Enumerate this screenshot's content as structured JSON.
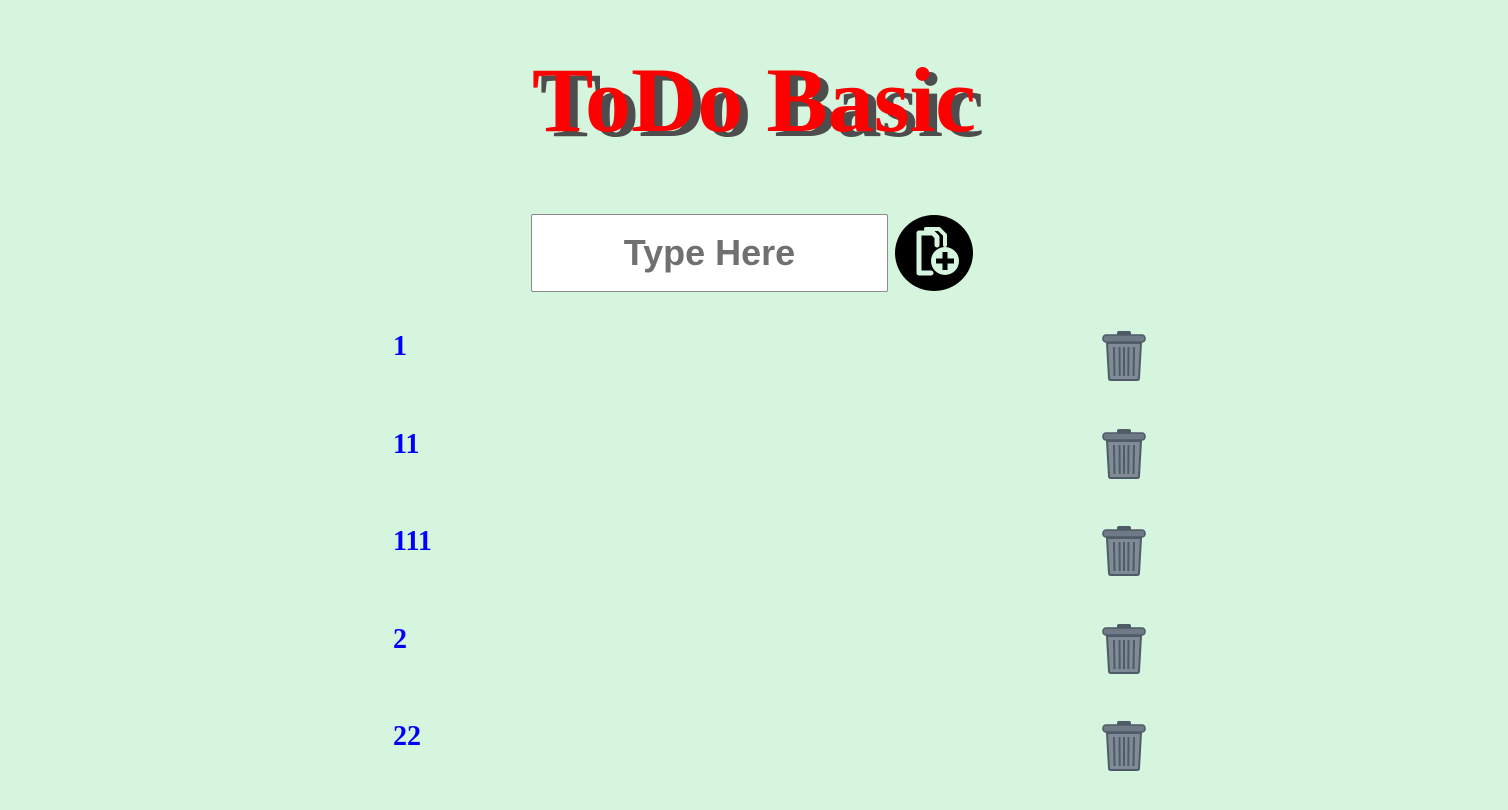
{
  "app": {
    "title": "ToDo Basic"
  },
  "input": {
    "placeholder": "Type Here",
    "value": ""
  },
  "add_button": {
    "icon": "file-plus-icon",
    "label": "Add task"
  },
  "todos": [
    {
      "text": "1",
      "delete_icon": "trash-icon"
    },
    {
      "text": "11",
      "delete_icon": "trash-icon"
    },
    {
      "text": "111",
      "delete_icon": "trash-icon"
    },
    {
      "text": "2",
      "delete_icon": "trash-icon"
    },
    {
      "text": "22",
      "delete_icon": "trash-icon"
    }
  ],
  "colors": {
    "background": "#d6f5df",
    "title": "#ff0000",
    "title_shadow": "#4d4d4d",
    "item_text": "#0000ff",
    "add_button": "#000000",
    "trash": "#6e7b87"
  }
}
